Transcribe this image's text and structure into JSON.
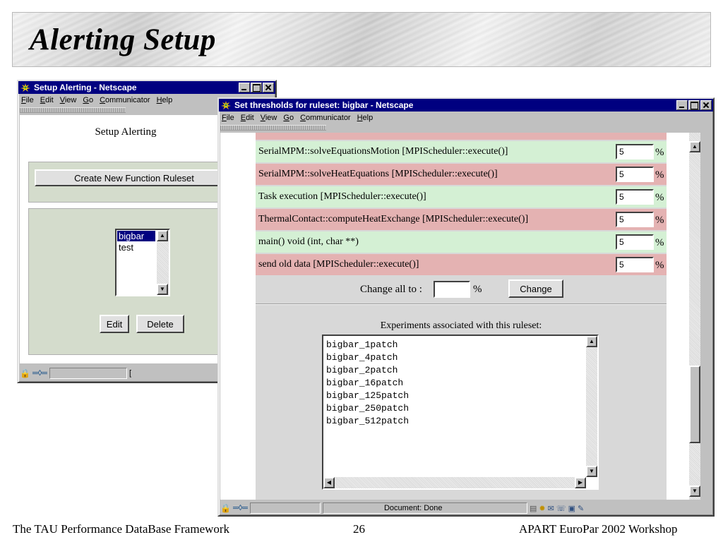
{
  "slide": {
    "title": "Alerting Setup",
    "footer_left": "The TAU Performance DataBase Framework",
    "page_number": "26",
    "footer_right": "APART EuroPar 2002 Workshop"
  },
  "window1": {
    "title": "Setup Alerting - Netscape",
    "menu": [
      "File",
      "Edit",
      "View",
      "Go",
      "Communicator",
      "Help"
    ],
    "heading": "Setup Alerting",
    "create_button": "Create New Function Ruleset",
    "rulesets": [
      "bigbar",
      "test"
    ],
    "selected_ruleset": "bigbar",
    "edit_button": "Edit",
    "delete_button": "Delete",
    "status_text": "[ "
  },
  "window2": {
    "title": "Set thresholds for ruleset: bigbar - Netscape",
    "menu": [
      "File",
      "Edit",
      "View",
      "Go",
      "Communicator",
      "Help"
    ],
    "rows": [
      {
        "label": "SerialMPM::solveEquationsMotion [MPIScheduler::execute()]",
        "value": "5",
        "unit": "%"
      },
      {
        "label": "SerialMPM::solveHeatEquations [MPIScheduler::execute()]",
        "value": "5",
        "unit": "%"
      },
      {
        "label": "Task execution [MPIScheduler::execute()]",
        "value": "5",
        "unit": "%"
      },
      {
        "label": "ThermalContact::computeHeatExchange [MPIScheduler::execute()]",
        "value": "5",
        "unit": "%"
      },
      {
        "label": "main() void (int, char **)",
        "value": "5",
        "unit": "%"
      },
      {
        "label": "send old data [MPIScheduler::execute()]",
        "value": "5",
        "unit": "%"
      }
    ],
    "change_all_label": "Change all to :",
    "change_all_value": "",
    "change_all_unit": "%",
    "change_button": "Change",
    "experiments_heading": "Experiments associated with this ruleset:",
    "experiments": [
      "bigbar_1patch",
      "bigbar_4patch",
      "bigbar_2patch",
      "bigbar_16patch",
      "bigbar_125patch",
      "bigbar_250patch",
      "bigbar_512patch"
    ],
    "status_text": "Document: Done"
  },
  "colors": {
    "row_green": "#d4f0d4",
    "row_red": "#e4b2b2",
    "titlebar": "#000080"
  }
}
